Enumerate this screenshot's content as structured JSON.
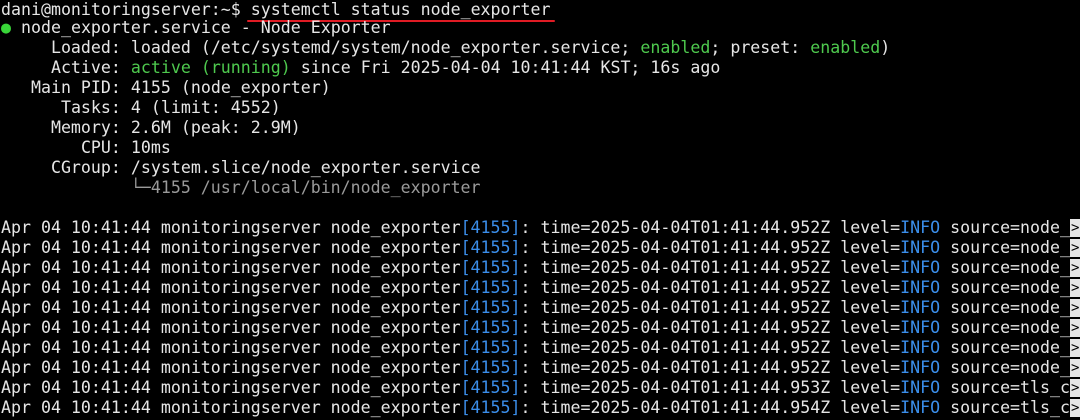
{
  "prompt": {
    "user_host": "dani@monitoringserver:~$",
    "command": "systemctl status node_exporter"
  },
  "service": {
    "bullet": "●",
    "header": "node_exporter.service - Node Exporter",
    "loaded_label": "Loaded:",
    "loaded_pre": "loaded (/etc/systemd/system/node_exporter.service;",
    "loaded_enabled": "enabled",
    "loaded_mid": "; preset:",
    "loaded_preset": "enabled",
    "loaded_post": ")",
    "active_label": "Active:",
    "active_state": "active (running)",
    "active_since": "since Fri 2025-04-04 10:41:44 KST; 16s ago",
    "pid_label": "Main PID:",
    "pid_value": "4155 (node_exporter)",
    "tasks_label": "Tasks:",
    "tasks_value": "4 (limit: 4552)",
    "memory_label": "Memory:",
    "memory_value": "2.6M (peak: 2.9M)",
    "cpu_label": "CPU:",
    "cpu_value": "10ms",
    "cgroup_label": "CGroup:",
    "cgroup_value": "/system.slice/node_exporter.service",
    "cgroup_child": "└─4155 /usr/local/bin/node_exporter"
  },
  "log": {
    "continuation": ">",
    "lines": [
      {
        "prefix": "Apr 04 10:41:44 monitoringserver node_exporter",
        "pid": "[4155]",
        "mid": ": time=2025-04-04T01:41:44.952Z level=",
        "level": "INFO",
        "tail": " source=node_"
      },
      {
        "prefix": "Apr 04 10:41:44 monitoringserver node_exporter",
        "pid": "[4155]",
        "mid": ": time=2025-04-04T01:41:44.952Z level=",
        "level": "INFO",
        "tail": " source=node_"
      },
      {
        "prefix": "Apr 04 10:41:44 monitoringserver node_exporter",
        "pid": "[4155]",
        "mid": ": time=2025-04-04T01:41:44.952Z level=",
        "level": "INFO",
        "tail": " source=node_"
      },
      {
        "prefix": "Apr 04 10:41:44 monitoringserver node_exporter",
        "pid": "[4155]",
        "mid": ": time=2025-04-04T01:41:44.952Z level=",
        "level": "INFO",
        "tail": " source=node_"
      },
      {
        "prefix": "Apr 04 10:41:44 monitoringserver node_exporter",
        "pid": "[4155]",
        "mid": ": time=2025-04-04T01:41:44.952Z level=",
        "level": "INFO",
        "tail": " source=node_"
      },
      {
        "prefix": "Apr 04 10:41:44 monitoringserver node_exporter",
        "pid": "[4155]",
        "mid": ": time=2025-04-04T01:41:44.952Z level=",
        "level": "INFO",
        "tail": " source=node_"
      },
      {
        "prefix": "Apr 04 10:41:44 monitoringserver node_exporter",
        "pid": "[4155]",
        "mid": ": time=2025-04-04T01:41:44.952Z level=",
        "level": "INFO",
        "tail": " source=node_"
      },
      {
        "prefix": "Apr 04 10:41:44 monitoringserver node_exporter",
        "pid": "[4155]",
        "mid": ": time=2025-04-04T01:41:44.952Z level=",
        "level": "INFO",
        "tail": " source=node_"
      },
      {
        "prefix": "Apr 04 10:41:44 monitoringserver node_exporter",
        "pid": "[4155]",
        "mid": ": time=2025-04-04T01:41:44.953Z level=",
        "level": "INFO",
        "tail": " source=tls_c"
      },
      {
        "prefix": "Apr 04 10:41:44 monitoringserver node_exporter",
        "pid": "[4155]",
        "mid": ": time=2025-04-04T01:41:44.954Z level=",
        "level": "INFO",
        "tail": " source=tls_c"
      }
    ]
  },
  "colors": {
    "background": "#000000",
    "text": "#e6e6e6",
    "green": "#4ec94e",
    "blue": "#3b8eea",
    "underline": "#e01b24"
  }
}
